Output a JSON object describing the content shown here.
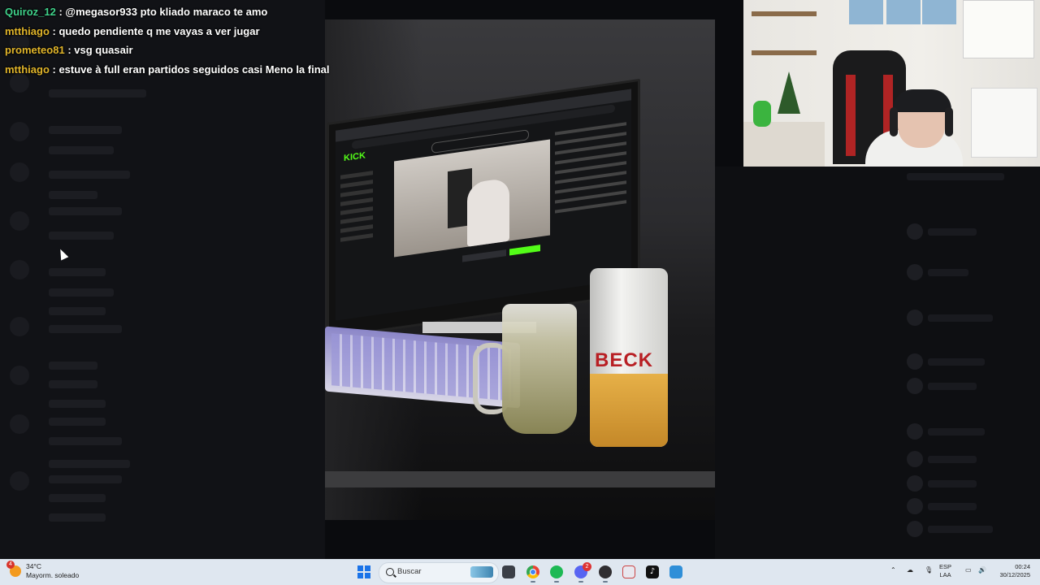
{
  "chat": [
    {
      "user": "Quiroz_12",
      "user_color": "#3fd18a",
      "message": ": @megasor933 pto kliado maraco te amo"
    },
    {
      "user": "mtthiago",
      "user_color": "#e1b52a",
      "message": ": quedo pendiente q me vayas a ver jugar"
    },
    {
      "user": "prometeo81",
      "user_color": "#e1b52a",
      "message": ": vsg quasair"
    },
    {
      "user": "mtthiago",
      "user_color": "#e1b52a",
      "message": ": estuve à full eran partidos seguidos casi Meno la final"
    }
  ],
  "photo": {
    "site_logo": "KICK",
    "can_brand": "BECK"
  },
  "taskbar": {
    "weather_temp": "34°C",
    "weather_desc": "Mayorm. soleado",
    "weather_badge": "4",
    "search_placeholder": "Buscar",
    "apps": [
      {
        "name": "file-explorer-icon"
      },
      {
        "name": "chrome-icon"
      },
      {
        "name": "spotify-icon"
      },
      {
        "name": "discord-icon",
        "badge": "2"
      },
      {
        "name": "obs-icon"
      },
      {
        "name": "snipping-tool-icon"
      },
      {
        "name": "tiktok-icon"
      },
      {
        "name": "notepad-icon"
      }
    ],
    "lang_line1": "ESP",
    "lang_line2": "LAA",
    "time": "00:24",
    "date": "30/12/2025"
  },
  "colors": {
    "taskbar_bg": "#dfe7f0",
    "kick_green": "#53fc18",
    "windows_blue": "#1a73e8"
  }
}
